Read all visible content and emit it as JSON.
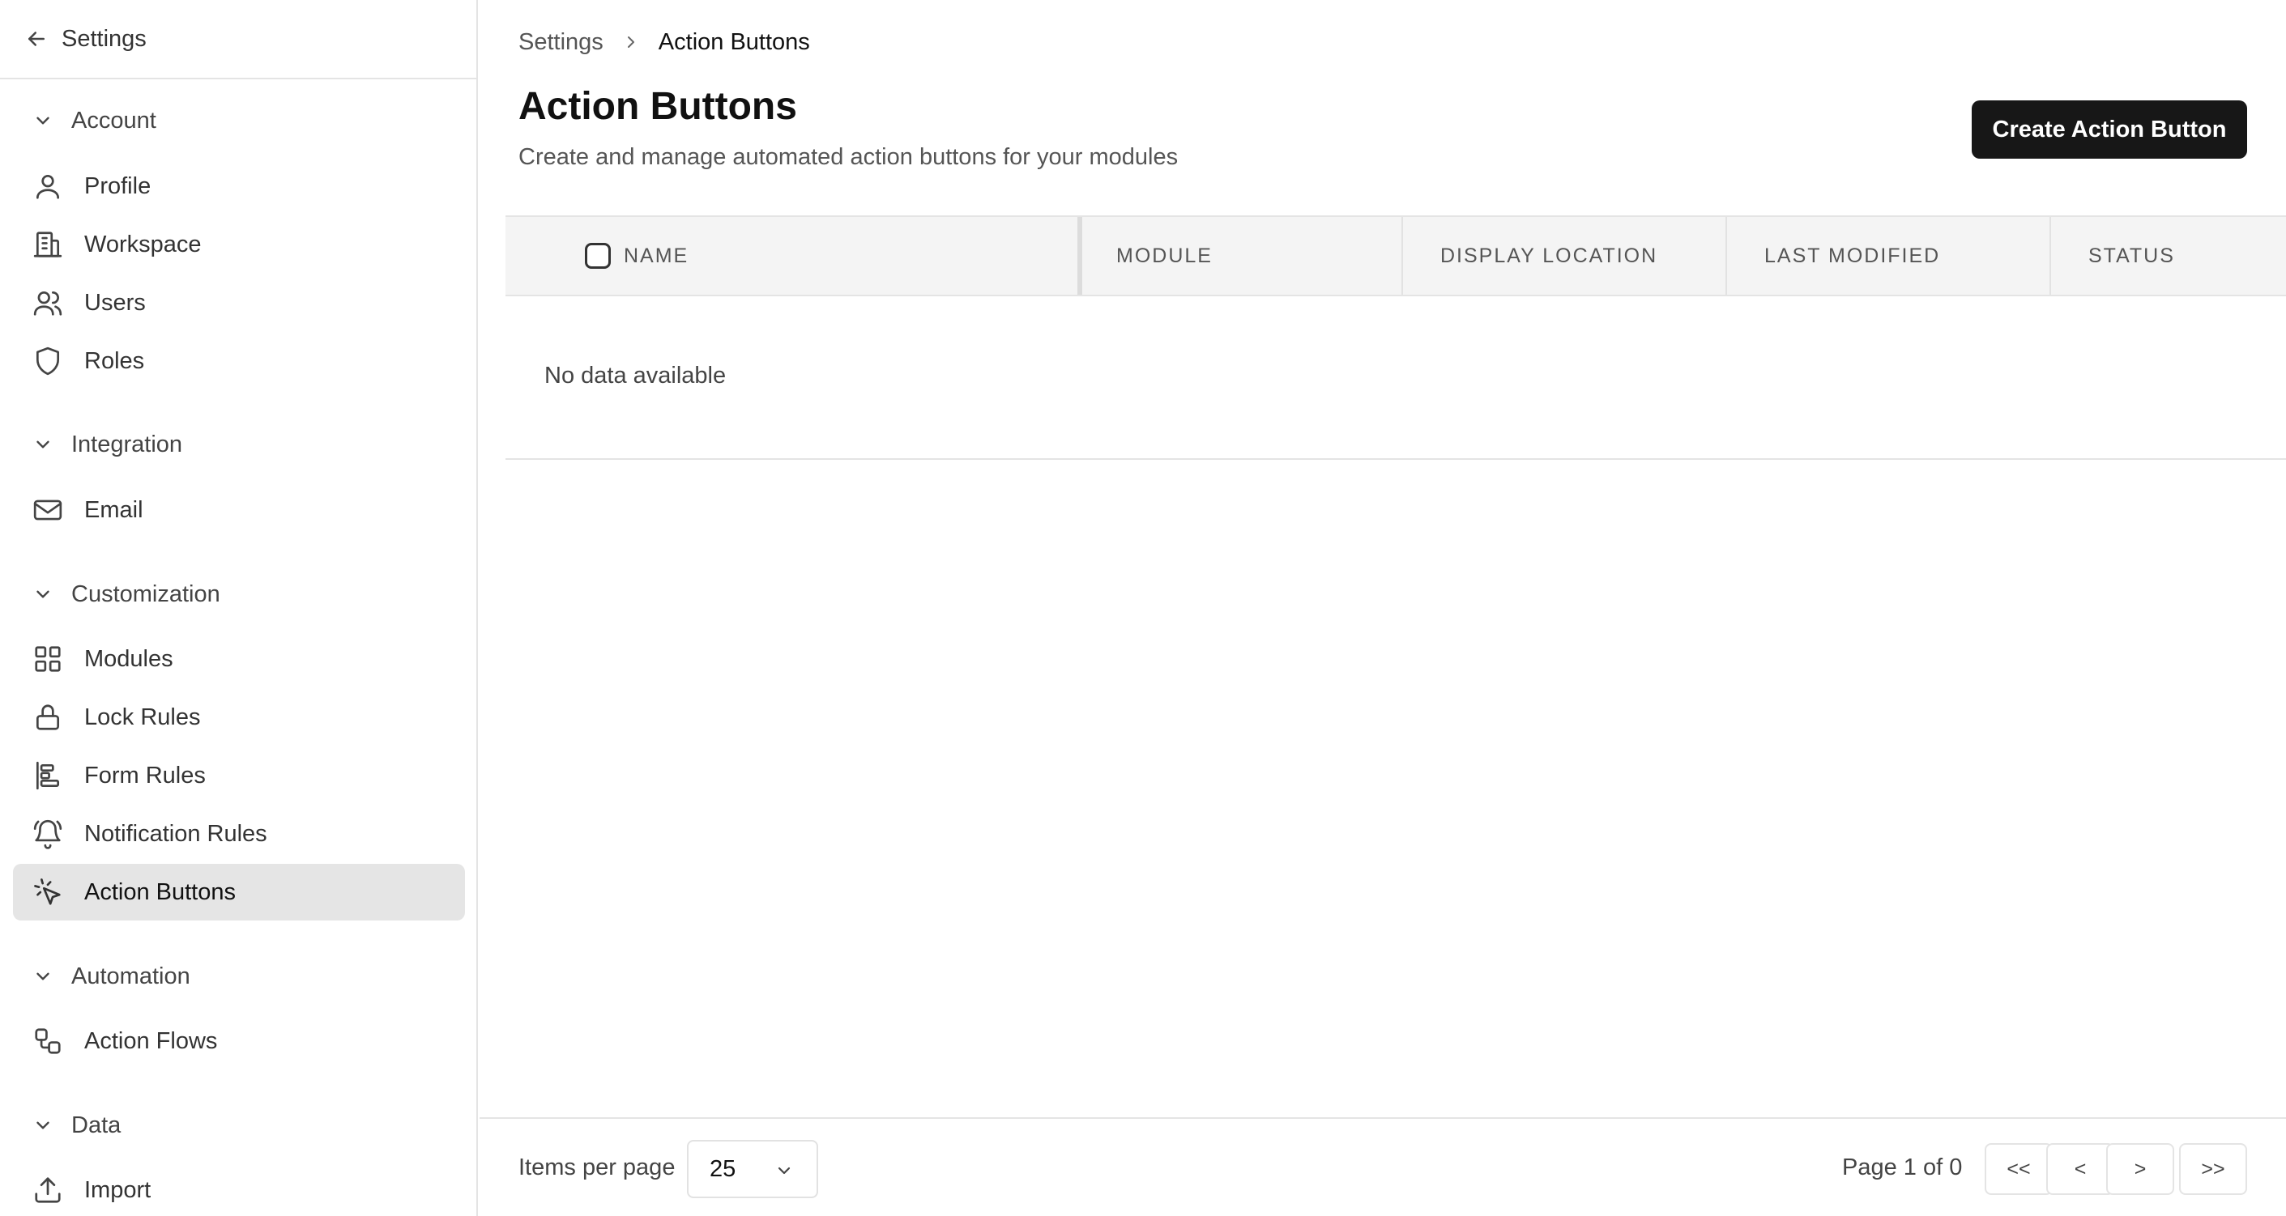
{
  "sidebar": {
    "back_label": "Settings",
    "sections": [
      {
        "label": "Account",
        "items": [
          {
            "label": "Profile",
            "icon": "user-icon"
          },
          {
            "label": "Workspace",
            "icon": "building-icon"
          },
          {
            "label": "Users",
            "icon": "users-icon"
          },
          {
            "label": "Roles",
            "icon": "shield-icon"
          }
        ]
      },
      {
        "label": "Integration",
        "items": [
          {
            "label": "Email",
            "icon": "mail-icon"
          }
        ]
      },
      {
        "label": "Customization",
        "items": [
          {
            "label": "Modules",
            "icon": "grid-icon"
          },
          {
            "label": "Lock Rules",
            "icon": "lock-icon"
          },
          {
            "label": "Form Rules",
            "icon": "align-left-icon"
          },
          {
            "label": "Notification Rules",
            "icon": "bell-icon"
          },
          {
            "label": "Action Buttons",
            "icon": "pointer-click-icon",
            "active": true
          }
        ]
      },
      {
        "label": "Automation",
        "items": [
          {
            "label": "Action Flows",
            "icon": "workflow-icon"
          }
        ]
      },
      {
        "label": "Data",
        "items": [
          {
            "label": "Import",
            "icon": "upload-icon"
          }
        ]
      }
    ]
  },
  "breadcrumb": {
    "parent": "Settings",
    "current": "Action Buttons"
  },
  "page": {
    "title": "Action Buttons",
    "subtitle": "Create and manage automated action buttons for your modules",
    "create_button": "Create Action Button"
  },
  "table": {
    "columns": [
      "NAME",
      "MODULE",
      "DISPLAY LOCATION",
      "LAST MODIFIED",
      "STATUS"
    ],
    "empty_message": "No data available",
    "rows": []
  },
  "pagination": {
    "items_per_page_label": "Items per page",
    "items_per_page": "25",
    "page_info": "Page 1 of 0",
    "first": "<<",
    "prev": "<",
    "next": ">",
    "last": ">>"
  },
  "colors": {
    "primary_button": "#171717",
    "active_nav_bg": "#e5e5e5",
    "border": "#e4e4e4",
    "header_bg": "#f4f4f4"
  }
}
